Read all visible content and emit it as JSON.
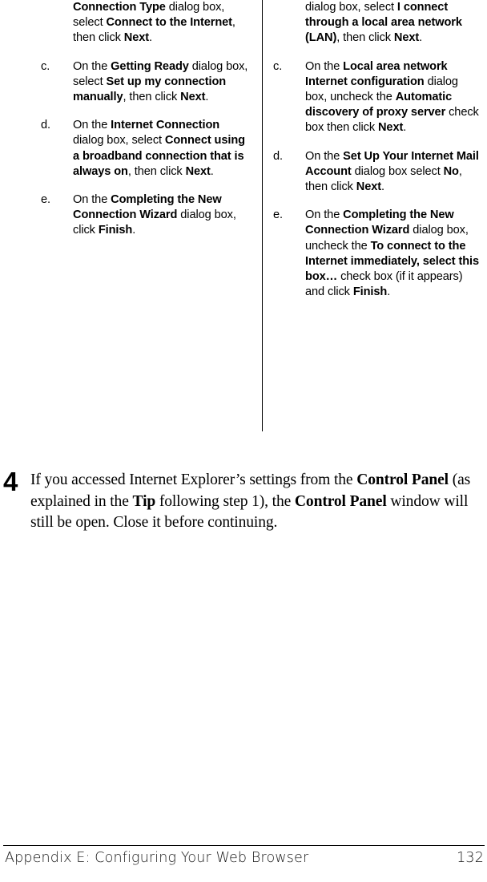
{
  "page": {
    "columns": {
      "left": {
        "items": [
          {
            "marker": "",
            "runs": [
              {
                "t": "Connection Type",
                "b": true
              },
              {
                "t": " dialog box, select ",
                "b": false
              },
              {
                "t": "Connect to the Internet",
                "b": true
              },
              {
                "t": ", then click ",
                "b": false
              },
              {
                "t": "Next",
                "b": true
              },
              {
                "t": ".",
                "b": false
              }
            ]
          },
          {
            "marker": "c.",
            "runs": [
              {
                "t": "On the ",
                "b": false
              },
              {
                "t": "Getting Ready",
                "b": true
              },
              {
                "t": " dialog box, select ",
                "b": false
              },
              {
                "t": "Set up my connection manually",
                "b": true
              },
              {
                "t": ", then click ",
                "b": false
              },
              {
                "t": "Next",
                "b": true
              },
              {
                "t": ".",
                "b": false
              }
            ]
          },
          {
            "marker": "d.",
            "runs": [
              {
                "t": "On the ",
                "b": false
              },
              {
                "t": "Internet Connection",
                "b": true
              },
              {
                "t": " dialog box, select ",
                "b": false
              },
              {
                "t": "Connect using a broadband connection that is always on",
                "b": true
              },
              {
                "t": ", then click ",
                "b": false
              },
              {
                "t": "Next",
                "b": true
              },
              {
                "t": ".",
                "b": false
              }
            ]
          },
          {
            "marker": "e.",
            "runs": [
              {
                "t": "On the ",
                "b": false
              },
              {
                "t": "Completing the New Connection Wizard",
                "b": true
              },
              {
                "t": " dialog box, click ",
                "b": false
              },
              {
                "t": "Finish",
                "b": true
              },
              {
                "t": ".",
                "b": false
              }
            ]
          }
        ]
      },
      "right": {
        "items": [
          {
            "marker": "",
            "runs": [
              {
                "t": "dialog box, select ",
                "b": false
              },
              {
                "t": "I connect through a local area network (LAN)",
                "b": true
              },
              {
                "t": ", then click ",
                "b": false
              },
              {
                "t": "Next",
                "b": true
              },
              {
                "t": ".",
                "b": false
              }
            ]
          },
          {
            "marker": "c.",
            "runs": [
              {
                "t": "On the ",
                "b": false
              },
              {
                "t": "Local area network Internet configuration",
                "b": true
              },
              {
                "t": " dialog box, uncheck the ",
                "b": false
              },
              {
                "t": "Automatic discovery of proxy server",
                "b": true
              },
              {
                "t": " check box then click ",
                "b": false
              },
              {
                "t": "Next",
                "b": true
              },
              {
                "t": ".",
                "b": false
              }
            ]
          },
          {
            "marker": "d.",
            "runs": [
              {
                "t": "On the ",
                "b": false
              },
              {
                "t": "Set Up Your Internet Mail Account",
                "b": true
              },
              {
                "t": " dialog box select ",
                "b": false
              },
              {
                "t": "No",
                "b": true
              },
              {
                "t": ", then click ",
                "b": false
              },
              {
                "t": "Next",
                "b": true
              },
              {
                "t": ".",
                "b": false
              }
            ]
          },
          {
            "marker": "e.",
            "runs": [
              {
                "t": "On the ",
                "b": false
              },
              {
                "t": "Completing the New Connection Wizard",
                "b": true
              },
              {
                "t": " dialog box, uncheck the ",
                "b": false
              },
              {
                "t": "To connect to the Internet immediately, select this box…",
                "b": true
              },
              {
                "t": " check box (if it appears) and click ",
                "b": false
              },
              {
                "t": "Finish",
                "b": true
              },
              {
                "t": ".",
                "b": false
              }
            ]
          }
        ]
      }
    },
    "step_four": {
      "number": "4",
      "runs": [
        {
          "t": "If you accessed Internet Explorer’s settings from the ",
          "b": false
        },
        {
          "t": "Control Panel",
          "b": true
        },
        {
          "t": " (as explained in the ",
          "b": false
        },
        {
          "t": "Tip",
          "b": true
        },
        {
          "t": " following step 1), the ",
          "b": false
        },
        {
          "t": "Control Panel",
          "b": true
        },
        {
          "t": " window will still be open. Close it before continuing.",
          "b": false
        }
      ]
    },
    "footer": {
      "title": "Appendix E: Configuring Your Web Browser",
      "page_number": "132"
    }
  }
}
